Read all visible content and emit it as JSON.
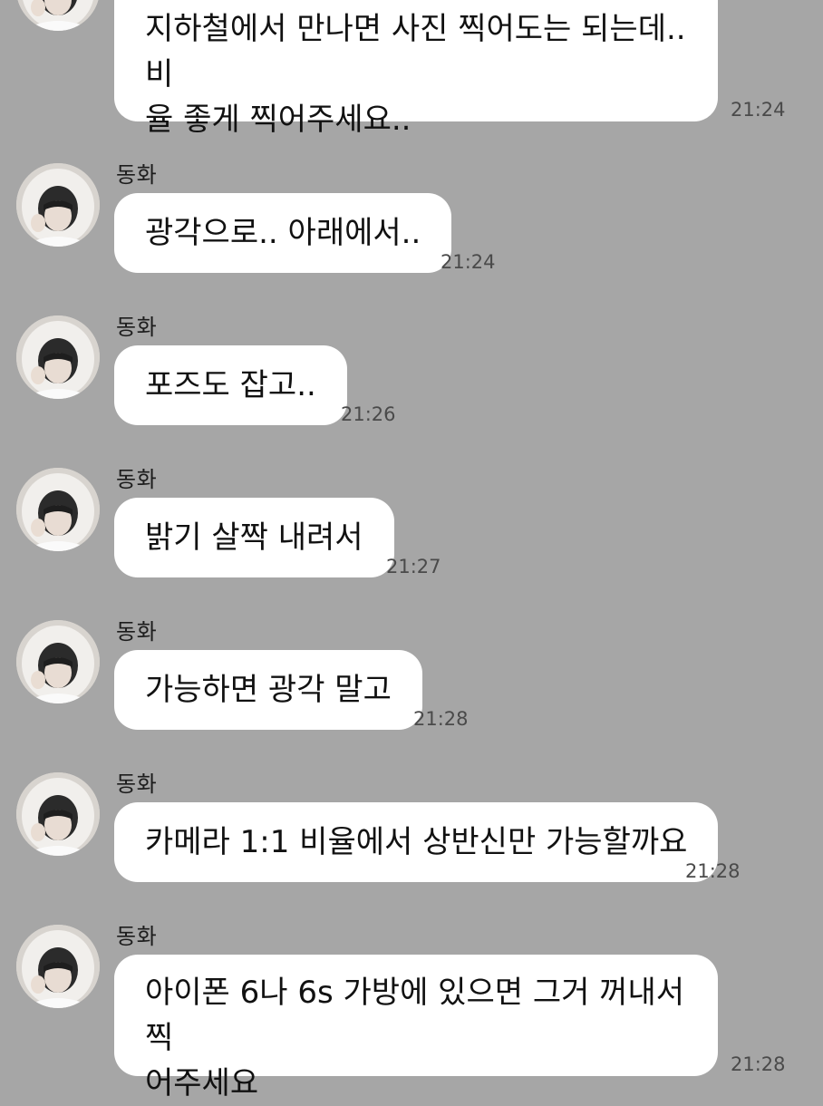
{
  "chat": {
    "messages": [
      {
        "sender": "",
        "lines": [
          "지하철에서 만나면 사진 찍어도는 되는데.. 비",
          "율 좋게 찍어주세요.."
        ],
        "time": "21:24"
      },
      {
        "sender": "동화",
        "lines": [
          "광각으로.. 아래에서.."
        ],
        "time": "21:24"
      },
      {
        "sender": "동화",
        "lines": [
          "포즈도 잡고.."
        ],
        "time": "21:26"
      },
      {
        "sender": "동화",
        "lines": [
          "밝기 살짝 내려서"
        ],
        "time": "21:27"
      },
      {
        "sender": "동화",
        "lines": [
          "가능하면 광각 말고"
        ],
        "time": "21:28"
      },
      {
        "sender": "동화",
        "lines": [
          "카메라 1:1 비율에서 상반신만 가능할까요"
        ],
        "time": "21:28"
      },
      {
        "sender": "동화",
        "lines": [
          "아이폰 6나 6s 가방에 있으면 그거 꺼내서 찍",
          "어주세요"
        ],
        "time": "21:28"
      }
    ],
    "colors": {
      "background": "#a6a6a6",
      "bubble": "#ffffff"
    },
    "avatar_icon": "profile-photo-icon"
  }
}
